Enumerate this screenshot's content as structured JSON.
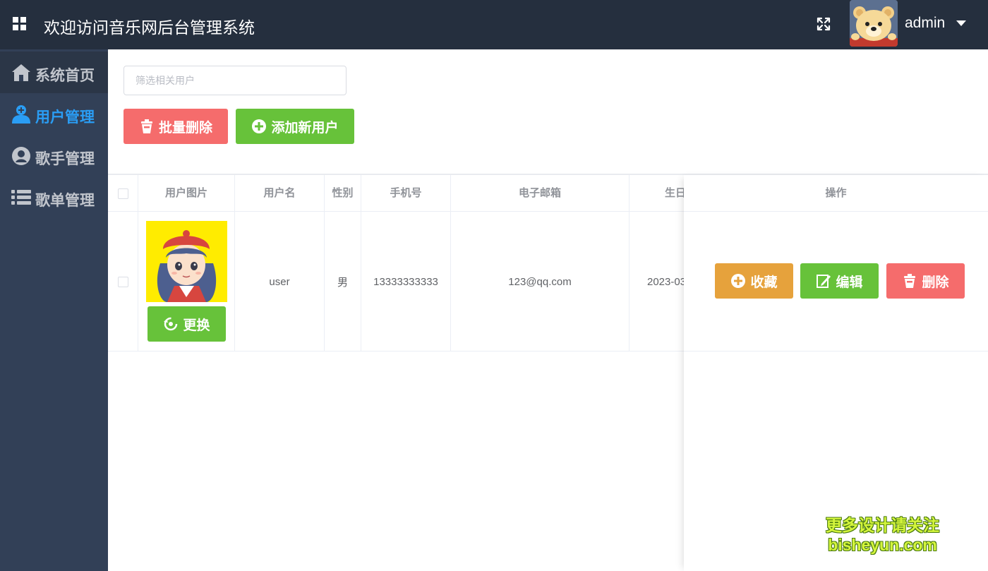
{
  "header": {
    "title": "欢迎访问音乐网后台管理系统",
    "username": "admin",
    "bg_color": "#252f3e"
  },
  "sidebar": {
    "bg_color": "#324057",
    "active_color": "#2a9df4",
    "items": [
      {
        "label": "系统首页",
        "icon": "home-icon"
      },
      {
        "label": "用户管理",
        "icon": "user-icon",
        "current": true
      },
      {
        "label": "歌手管理",
        "icon": "singer-icon"
      },
      {
        "label": "歌单管理",
        "icon": "list-icon"
      }
    ]
  },
  "toolbar": {
    "search_placeholder": "筛选相关用户",
    "batch_delete_label": "批量删除",
    "add_user_label": "添加新用户"
  },
  "table": {
    "columns": [
      "用户图片",
      "用户名",
      "性别",
      "手机号",
      "电子邮箱",
      "生日",
      "操作"
    ],
    "rows": [
      {
        "username": "user",
        "gender": "男",
        "phone": "13333333333",
        "email": "123@qq.com",
        "birthday": "2023-03",
        "change_label": "更换"
      }
    ],
    "actions": {
      "favorite_label": "收藏",
      "edit_label": "编辑",
      "delete_label": "删除"
    }
  },
  "colors": {
    "danger": "#f56c6c",
    "success": "#67c23a",
    "warning": "#e6a23c"
  },
  "watermark": {
    "line1": "更多设计请关注",
    "line2": "bisheyun.com"
  }
}
